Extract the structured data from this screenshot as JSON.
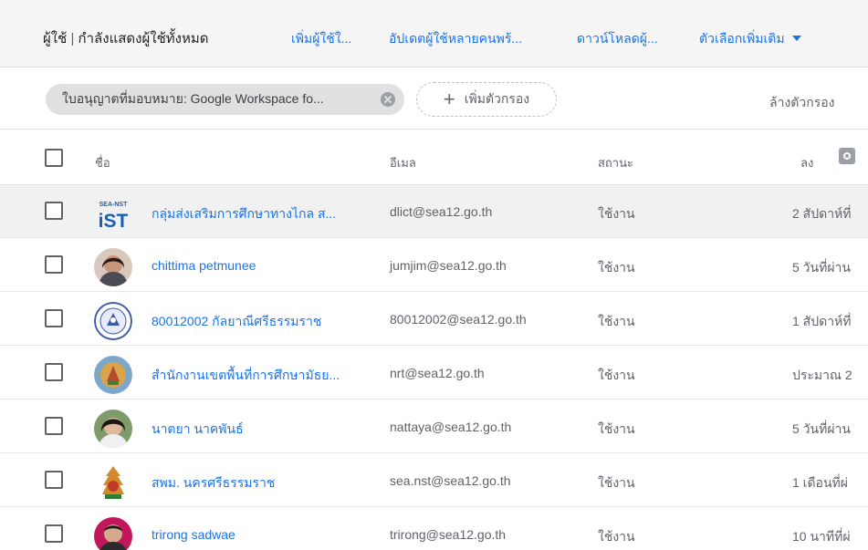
{
  "toolbar": {
    "title": "ผู้ใช้",
    "title_sep": "|",
    "subtitle": "กำลังแสดงผู้ใช้ทั้งหมด",
    "add_user": "เพิ่มผู้ใช้ใ...",
    "bulk_update": "อัปเดตผู้ใช้หลายคนพร้...",
    "download": "ดาวน์โหลดผู้...",
    "more_options": "ตัวเลือกเพิ่มเติม"
  },
  "filters": {
    "chip": "ใบอนุญาตที่มอบหมาย: Google Workspace fo...",
    "add_filter": "เพิ่มตัวกรอง",
    "clear": "ล้างตัวกรอง"
  },
  "table": {
    "headers": {
      "name": "ชื่อ",
      "email": "อีเมล",
      "status": "สถานะ",
      "last_signin": "ลง"
    },
    "rows": [
      {
        "name": "กลุ่มส่งเสริมการศึกษาทางไกล ส...",
        "email": "dlict@sea12.go.th",
        "status": "ใช้งาน",
        "last": "2 สัปดาห์ที่",
        "avatar": "logo-ist"
      },
      {
        "name": "chittima petmunee",
        "email": "jumjim@sea12.go.th",
        "status": "ใช้งาน",
        "last": "5 วันที่ผ่าน",
        "avatar": "photo"
      },
      {
        "name": "80012002 กัลยาณีศรีธรรมราช",
        "email": "80012002@sea12.go.th",
        "status": "ใช้งาน",
        "last": "1 สัปดาห์ที่",
        "avatar": "school-seal"
      },
      {
        "name": "สำนักงานเขตพื้นที่การศึกษามัธย...",
        "email": "nrt@sea12.go.th",
        "status": "ใช้งาน",
        "last": "ประมาณ 2",
        "avatar": "office-emblem"
      },
      {
        "name": "นาตยา นาคพันธ์",
        "email": "nattaya@sea12.go.th",
        "status": "ใช้งาน",
        "last": "5 วันที่ผ่าน",
        "avatar": "photo"
      },
      {
        "name": "สพม. นครศรีธรรมราช",
        "email": "sea.nst@sea12.go.th",
        "status": "ใช้งาน",
        "last": "1 เดือนที่ผ่",
        "avatar": "office-emblem"
      },
      {
        "name": "trirong sadwae",
        "email": "trirong@sea12.go.th",
        "status": "ใช้งาน",
        "last": "10 นาทีที่ผ่",
        "avatar": "photo"
      }
    ]
  },
  "colors": {
    "link": "#1a73e8",
    "toolbar_bg": "#f5f5f5",
    "chip_bg": "#e0e0e0",
    "hover_row": "#f1f1f1"
  }
}
